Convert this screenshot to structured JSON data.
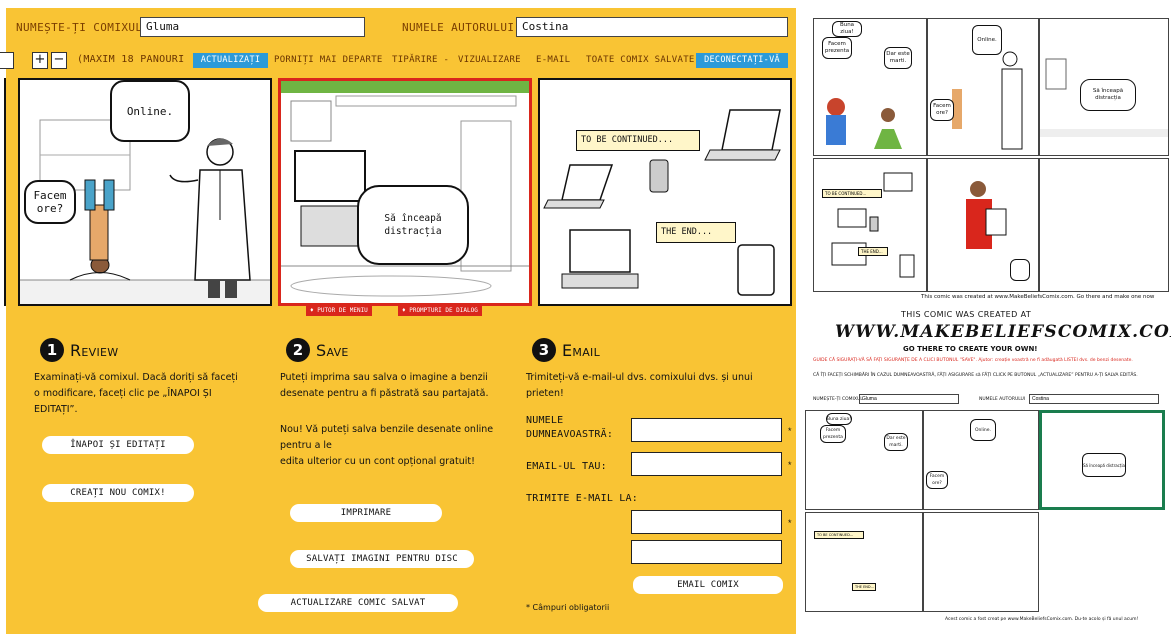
{
  "header": {
    "comic_name_label": "NUMEȘTE-ȚI COMIXUL",
    "comic_name_value": "Gluma",
    "author_label": "NUMELE AUTORULUI",
    "author_value": "Costina"
  },
  "toolbar": {
    "plus": "+",
    "minus": "−",
    "max_panels": "(MAXIM 18 PANOURI",
    "update": "ACTUALIZAȚI",
    "continue": "PORNIȚI MAI DEPARTE",
    "print": "TIPĂRIRE -",
    "view": "VIZUALIZARE",
    "email": "E-MAIL",
    "all_saved": "TOATE COMIX SALVATE",
    "logout": "DECONECTAȚI-VĂ"
  },
  "panels": {
    "p1": {
      "bubble1": "Online.",
      "bubble2": "Facem ore?"
    },
    "p2": {
      "bubble1": "Să înceapă distracția",
      "tag1": "♦ PUTOR DE MENIU",
      "tag2": "♦ PROMPTURI DE DIALOG"
    },
    "p3": {
      "caption1": "TO BE CONTINUED...",
      "caption2": "THE END..."
    }
  },
  "review": {
    "num": "1",
    "title": "Review",
    "text": "Examinați-vă comixul. Dacă doriți să faceți o modificare, faceți clic pe „ÎNAPOI ȘI EDITAȚI”.",
    "back_edit": "ÎNAPOI ȘI EDITAȚI",
    "new_comix": "CREAȚI NOU COMIX!"
  },
  "save": {
    "num": "2",
    "title": "Save",
    "text1": "Puteți imprima sau salva o imagine a benzii desenate pentru a fi păstrată sau partajată.",
    "text2": "Nou! Vă puteți salva benzile desenate online pentru a le",
    "text3": "edita ulterior cu un cont opțional gratuit!",
    "print": "IMPRIMARE",
    "save_images": "SALVAȚI IMAGINI PENTRU DISC",
    "update_saved": "ACTUALIZARE COMIC SALVAT"
  },
  "email": {
    "num": "3",
    "title": "Email",
    "text": "Trimiteți-vă e-mail-ul dvs. comixului dvs. și unui prieten!",
    "your_name": "NUMELE DUMNEAVOASTRĂ:",
    "your_email": "EMAIL-UL TAU:",
    "send_to": "TRIMITE E-MAIL LA:",
    "send_btn": "EMAIL COMIX",
    "required_note": "* Câmpuri obligatorii",
    "asterisk": "*"
  },
  "preview": {
    "p1_b1": "Buna ziua!",
    "p1_b2": "Facem prezenta",
    "p1_b3": "Dar este marti.",
    "p2_b1": "Online.",
    "p2_b2": "Facem ore?",
    "p3_b1": "Să înceapă distracția",
    "p5_c1": "TO BE CONTINUED...",
    "p5_c2": "THE END...",
    "footer1": "This comic was created at www.MakeBeliefsComix.com. Go there and make one now",
    "created_at": "THIS COMIC WAS CREATED AT",
    "site": "WWW.MAKEBELIEFSCOMIX.COM",
    "go_there": "GO THERE TO CREATE YOUR OWN!",
    "red_note": "GUIDE CĂ SIGURAȚI-VĂ SĂ FAȚI SIGURANȚE DE A CLICI BUTONUL \"SAVE\". Ajutor: creație voastră ne fi adăugată LISTEI dvs. de benzi desenate.",
    "black_note": "CĂ ÎȚI FACEȚI SCHIMBĂRI ÎN CAZUL DUMNEAVOASTRĂ, FĂȚI ASIGURARE să FĂȚI CLICK PE BUTONUL „ACTUALIZARE” PENTRU A-ȚI SALVA EDITĂS.",
    "name_label": "NUMEȘTE-ȚI COMIXUL",
    "name_value": "Gluma",
    "author_label": "NUMELE AUTORULUI",
    "author_value": "Costina",
    "footer2": "Acest comic a fost creat pe www.MakeBeliefsComix.com. Du-te acolo și fă unul acum!"
  }
}
